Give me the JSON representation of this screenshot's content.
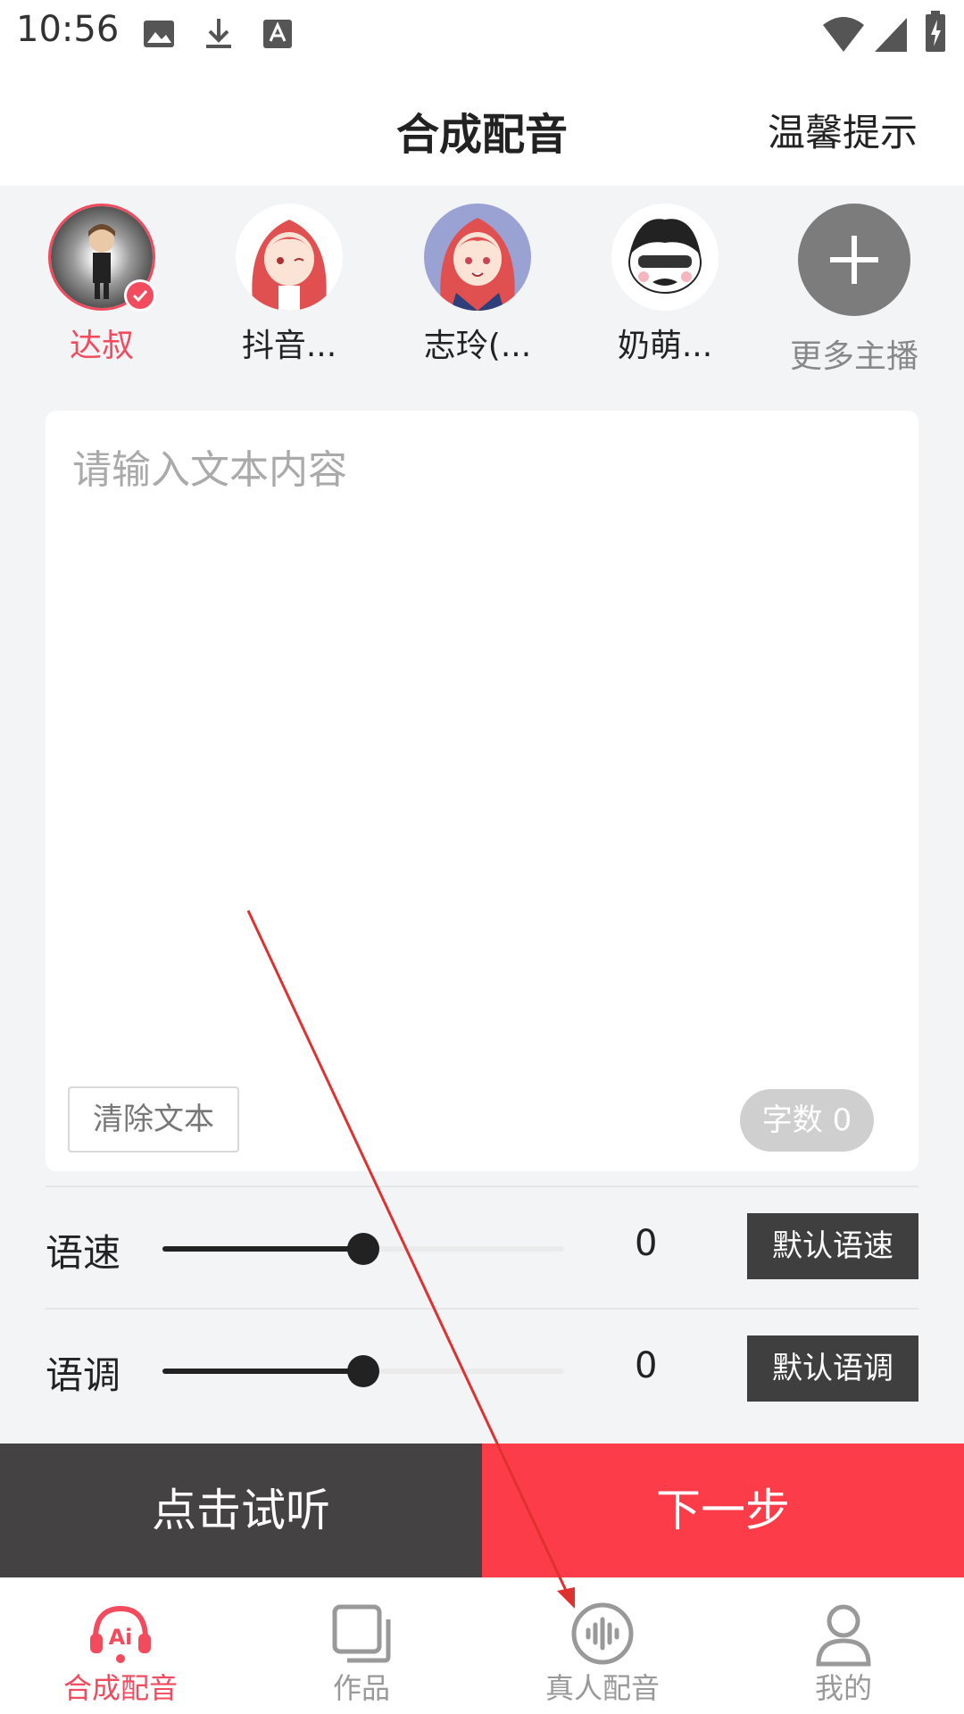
{
  "status_bar": {
    "time": "10:56"
  },
  "header": {
    "title": "合成配音",
    "tip": "温馨提示"
  },
  "anchors": [
    {
      "name": "达叔",
      "selected": true
    },
    {
      "name": "抖音...",
      "selected": false
    },
    {
      "name": "志玲(...",
      "selected": false
    },
    {
      "name": "奶萌...",
      "selected": false
    }
  ],
  "more_anchors": {
    "label": "更多主播"
  },
  "editor": {
    "placeholder": "请输入文本内容",
    "value": "",
    "clear_label": "清除文本",
    "count_label": "字数 0"
  },
  "speed": {
    "label": "语速",
    "value": "0",
    "level_fraction": 0.5,
    "default_label": "默认语速"
  },
  "pitch": {
    "label": "语调",
    "value": "0",
    "level_fraction": 0.5,
    "default_label": "默认语调"
  },
  "actions": {
    "listen_label": "点击试听",
    "next_label": "下一步"
  },
  "nav": [
    {
      "label": "合成配音",
      "icon": "ai-headphones-icon",
      "active": true
    },
    {
      "label": "作品",
      "icon": "works-icon",
      "active": false
    },
    {
      "label": "真人配音",
      "icon": "voice-wave-icon",
      "active": false
    },
    {
      "label": "我的",
      "icon": "person-icon",
      "active": false
    }
  ],
  "colors": {
    "accent": "#f24b5e",
    "next_button": "#fc3d49",
    "listen_button": "#444242",
    "annotation_arrow": "#e03131"
  }
}
